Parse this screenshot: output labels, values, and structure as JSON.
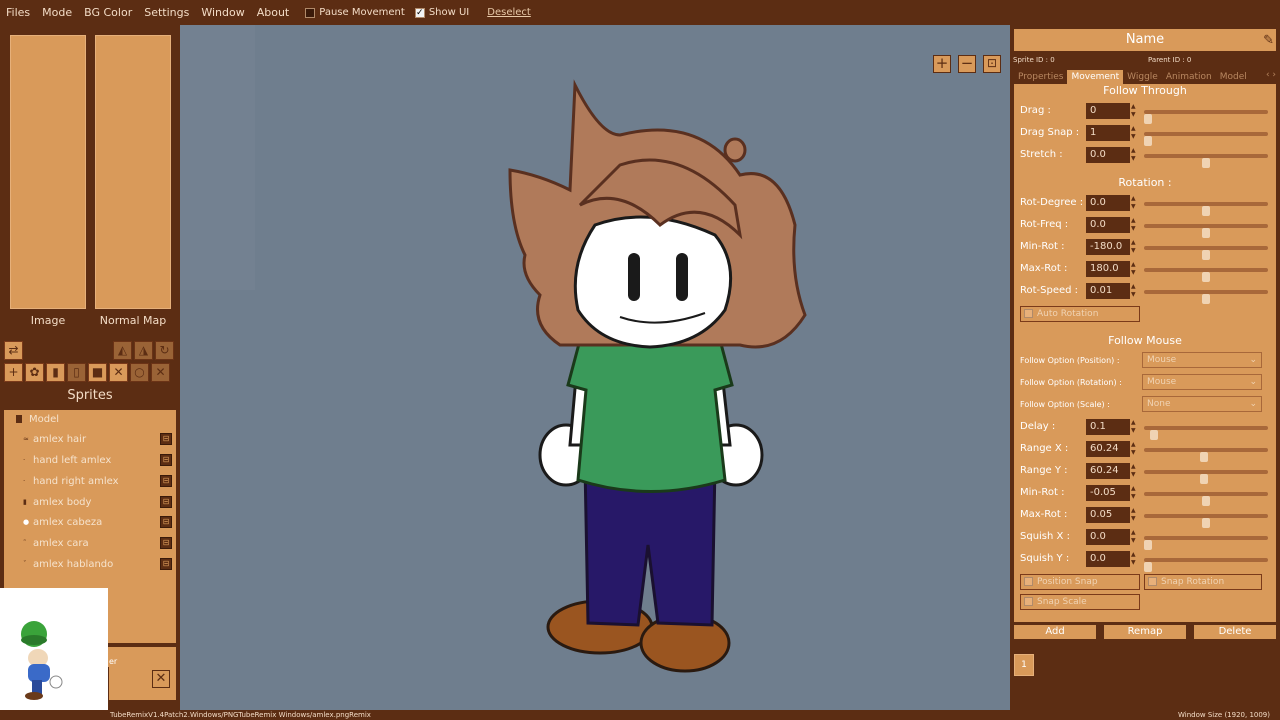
{
  "menu": {
    "items": [
      "Files",
      "Mode",
      "BG Color",
      "Settings",
      "Window",
      "About"
    ],
    "pause_movement": "Pause Movement",
    "show_ui": "Show UI",
    "deselect": "Deselect"
  },
  "left_panel": {
    "image_label": "Image",
    "normal_map_label": "Normal Map",
    "sprites_title": "Sprites",
    "tree": [
      {
        "label": "Model"
      },
      {
        "label": "amlex hair"
      },
      {
        "label": "hand left amlex"
      },
      {
        "label": "hand right amlex"
      },
      {
        "label": "amlex body"
      },
      {
        "label": "amlex cabeza"
      },
      {
        "label": "amlex cara"
      },
      {
        "label": "amlex hablando"
      }
    ],
    "dock_label": "er"
  },
  "status": {
    "path": "TubeRemixV1.4Patch2.Windows/PNGTubeRemix Windows/amlex.pngRemix",
    "window_size": "Window Size (1920, 1009)"
  },
  "right_panel": {
    "name": "Name",
    "sprite_id": "Sprite ID : 0",
    "parent_id": "Parent ID : 0",
    "tabs": [
      "Properties",
      "Movement",
      "Wiggle",
      "Animation",
      "Model"
    ],
    "active_tab": "Movement",
    "follow_through": {
      "title": "Follow Through",
      "drag_label": "Drag :",
      "drag": "0",
      "drag_snap_label": "Drag Snap :",
      "drag_snap": "1",
      "stretch_label": "Stretch :",
      "stretch": "0.0"
    },
    "rotation": {
      "title": "Rotation :",
      "rot_degree_label": "Rot-Degree :",
      "rot_degree": "0.0",
      "rot_freq_label": "Rot-Freq :",
      "rot_freq": "0.0",
      "min_rot_label": "Min-Rot :",
      "min_rot": "-180.0",
      "max_rot_label": "Max-Rot :",
      "max_rot": "180.0",
      "rot_speed_label": "Rot-Speed :",
      "rot_speed": "0.01",
      "auto_rotation": "Auto Rotation"
    },
    "follow_mouse": {
      "title": "Follow Mouse",
      "opt_position_label": "Follow Option (Position) :",
      "opt_position": "Mouse",
      "opt_rotation_label": "Follow Option (Rotation) :",
      "opt_rotation": "Mouse",
      "opt_scale_label": "Follow Option (Scale) :",
      "opt_scale": "None",
      "delay_label": "Delay :",
      "delay": "0.1",
      "range_x_label": "Range X :",
      "range_x": "60.24",
      "range_y_label": "Range Y :",
      "range_y": "60.24",
      "min_rot_label": "Min-Rot :",
      "min_rot": "-0.05",
      "max_rot_label": "Max-Rot :",
      "max_rot": "0.05",
      "squish_x_label": "Squish X :",
      "squish_x": "0.0",
      "squish_y_label": "Squish Y :",
      "squish_y": "0.0",
      "position_snap": "Position Snap",
      "snap_rotation": "Snap Rotation",
      "snap_scale": "Snap Scale"
    },
    "buttons": {
      "add": "Add",
      "remap": "Remap",
      "delete": "Delete"
    },
    "page": "1"
  },
  "colors": {
    "panel_dark": "#5c2d13",
    "panel_light": "#d99a5a",
    "canvas_bg": "#6f7e8e"
  }
}
